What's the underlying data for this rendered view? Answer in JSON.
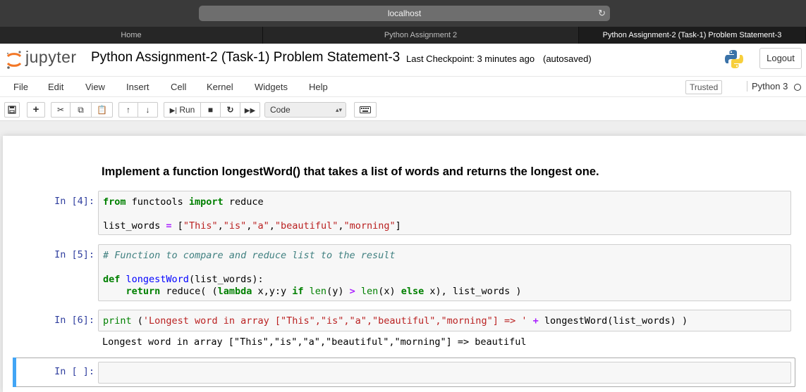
{
  "browser": {
    "url": "localhost",
    "tabs": [
      {
        "label": "Home"
      },
      {
        "label": "Python Assignment 2"
      },
      {
        "label": "Python Assignment-2 (Task-1) Problem Statement-3"
      }
    ]
  },
  "header": {
    "logo_text": "jupyter",
    "notebook_title": "Python Assignment-2 (Task-1) Problem Statement-3",
    "checkpoint": "Last Checkpoint: 3 minutes ago",
    "autosaved": "(autosaved)",
    "logout_label": "Logout"
  },
  "menubar": {
    "items": [
      "File",
      "Edit",
      "View",
      "Insert",
      "Cell",
      "Kernel",
      "Widgets",
      "Help"
    ],
    "trusted": "Trusted",
    "kernel": "Python 3"
  },
  "toolbar": {
    "run_label": "Run",
    "cell_type": "Code"
  },
  "cells": {
    "markdown": "Implement a function longestWord() that takes a list of words and returns the longest one.",
    "c1": {
      "prompt": "In [4]:",
      "line1_from": "from",
      "line1_mod": " functools ",
      "line1_import": "import",
      "line1_name": " reduce",
      "line2_var": "list_words ",
      "line2_eq": "=",
      "line2_open": " [",
      "s_this": "\"This\"",
      "s_is": "\"is\"",
      "s_a": "\"a\"",
      "s_beautiful": "\"beautiful\"",
      "s_morning": "\"morning\"",
      "comma": ",",
      "close": "]"
    },
    "c2": {
      "prompt": "In [5]:",
      "comment": "# Function to compare and reduce list to the result",
      "def": "def",
      "fname": "longestWord",
      "params": "(list_words):",
      "indent": "    ",
      "ret": "return",
      "reduce_open": " reduce( (",
      "lambda": "lambda",
      "lam_args": " x,y:y ",
      "if": "if",
      "len1": "len",
      "len1_arg": "(y) ",
      "gt": ">",
      "len2": "len",
      "len2_arg": "(x) ",
      "else": "else",
      "tail": " x), list_words )"
    },
    "c3": {
      "prompt": "In [6]:",
      "print": "print",
      "paren_open": " (",
      "str": "'Longest word in array [\"This\",\"is\",\"a\",\"beautiful\",\"morning\"] => '",
      "plus": "+",
      "call": " longestWord(list_words) ",
      "paren_close": ")",
      "output": "Longest word in array [\"This\",\"is\",\"a\",\"beautiful\",\"morning\"] => beautiful"
    },
    "c4": {
      "prompt": "In [ ]:"
    }
  }
}
